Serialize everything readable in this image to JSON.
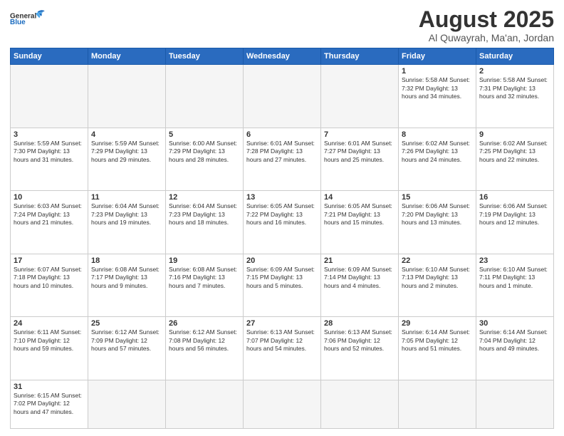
{
  "logo": {
    "text_general": "General",
    "text_blue": "Blue"
  },
  "header": {
    "title": "August 2025",
    "subtitle": "Al Quwayrah, Ma'an, Jordan"
  },
  "weekdays": [
    "Sunday",
    "Monday",
    "Tuesday",
    "Wednesday",
    "Thursday",
    "Friday",
    "Saturday"
  ],
  "weeks": [
    [
      {
        "day": "",
        "info": ""
      },
      {
        "day": "",
        "info": ""
      },
      {
        "day": "",
        "info": ""
      },
      {
        "day": "",
        "info": ""
      },
      {
        "day": "",
        "info": ""
      },
      {
        "day": "1",
        "info": "Sunrise: 5:58 AM\nSunset: 7:32 PM\nDaylight: 13 hours and 34 minutes."
      },
      {
        "day": "2",
        "info": "Sunrise: 5:58 AM\nSunset: 7:31 PM\nDaylight: 13 hours and 32 minutes."
      }
    ],
    [
      {
        "day": "3",
        "info": "Sunrise: 5:59 AM\nSunset: 7:30 PM\nDaylight: 13 hours and 31 minutes."
      },
      {
        "day": "4",
        "info": "Sunrise: 5:59 AM\nSunset: 7:29 PM\nDaylight: 13 hours and 29 minutes."
      },
      {
        "day": "5",
        "info": "Sunrise: 6:00 AM\nSunset: 7:29 PM\nDaylight: 13 hours and 28 minutes."
      },
      {
        "day": "6",
        "info": "Sunrise: 6:01 AM\nSunset: 7:28 PM\nDaylight: 13 hours and 27 minutes."
      },
      {
        "day": "7",
        "info": "Sunrise: 6:01 AM\nSunset: 7:27 PM\nDaylight: 13 hours and 25 minutes."
      },
      {
        "day": "8",
        "info": "Sunrise: 6:02 AM\nSunset: 7:26 PM\nDaylight: 13 hours and 24 minutes."
      },
      {
        "day": "9",
        "info": "Sunrise: 6:02 AM\nSunset: 7:25 PM\nDaylight: 13 hours and 22 minutes."
      }
    ],
    [
      {
        "day": "10",
        "info": "Sunrise: 6:03 AM\nSunset: 7:24 PM\nDaylight: 13 hours and 21 minutes."
      },
      {
        "day": "11",
        "info": "Sunrise: 6:04 AM\nSunset: 7:23 PM\nDaylight: 13 hours and 19 minutes."
      },
      {
        "day": "12",
        "info": "Sunrise: 6:04 AM\nSunset: 7:23 PM\nDaylight: 13 hours and 18 minutes."
      },
      {
        "day": "13",
        "info": "Sunrise: 6:05 AM\nSunset: 7:22 PM\nDaylight: 13 hours and 16 minutes."
      },
      {
        "day": "14",
        "info": "Sunrise: 6:05 AM\nSunset: 7:21 PM\nDaylight: 13 hours and 15 minutes."
      },
      {
        "day": "15",
        "info": "Sunrise: 6:06 AM\nSunset: 7:20 PM\nDaylight: 13 hours and 13 minutes."
      },
      {
        "day": "16",
        "info": "Sunrise: 6:06 AM\nSunset: 7:19 PM\nDaylight: 13 hours and 12 minutes."
      }
    ],
    [
      {
        "day": "17",
        "info": "Sunrise: 6:07 AM\nSunset: 7:18 PM\nDaylight: 13 hours and 10 minutes."
      },
      {
        "day": "18",
        "info": "Sunrise: 6:08 AM\nSunset: 7:17 PM\nDaylight: 13 hours and 9 minutes."
      },
      {
        "day": "19",
        "info": "Sunrise: 6:08 AM\nSunset: 7:16 PM\nDaylight: 13 hours and 7 minutes."
      },
      {
        "day": "20",
        "info": "Sunrise: 6:09 AM\nSunset: 7:15 PM\nDaylight: 13 hours and 5 minutes."
      },
      {
        "day": "21",
        "info": "Sunrise: 6:09 AM\nSunset: 7:14 PM\nDaylight: 13 hours and 4 minutes."
      },
      {
        "day": "22",
        "info": "Sunrise: 6:10 AM\nSunset: 7:13 PM\nDaylight: 13 hours and 2 minutes."
      },
      {
        "day": "23",
        "info": "Sunrise: 6:10 AM\nSunset: 7:11 PM\nDaylight: 13 hours and 1 minute."
      }
    ],
    [
      {
        "day": "24",
        "info": "Sunrise: 6:11 AM\nSunset: 7:10 PM\nDaylight: 12 hours and 59 minutes."
      },
      {
        "day": "25",
        "info": "Sunrise: 6:12 AM\nSunset: 7:09 PM\nDaylight: 12 hours and 57 minutes."
      },
      {
        "day": "26",
        "info": "Sunrise: 6:12 AM\nSunset: 7:08 PM\nDaylight: 12 hours and 56 minutes."
      },
      {
        "day": "27",
        "info": "Sunrise: 6:13 AM\nSunset: 7:07 PM\nDaylight: 12 hours and 54 minutes."
      },
      {
        "day": "28",
        "info": "Sunrise: 6:13 AM\nSunset: 7:06 PM\nDaylight: 12 hours and 52 minutes."
      },
      {
        "day": "29",
        "info": "Sunrise: 6:14 AM\nSunset: 7:05 PM\nDaylight: 12 hours and 51 minutes."
      },
      {
        "day": "30",
        "info": "Sunrise: 6:14 AM\nSunset: 7:04 PM\nDaylight: 12 hours and 49 minutes."
      }
    ],
    [
      {
        "day": "31",
        "info": "Sunrise: 6:15 AM\nSunset: 7:02 PM\nDaylight: 12 hours and 47 minutes."
      },
      {
        "day": "",
        "info": ""
      },
      {
        "day": "",
        "info": ""
      },
      {
        "day": "",
        "info": ""
      },
      {
        "day": "",
        "info": ""
      },
      {
        "day": "",
        "info": ""
      },
      {
        "day": "",
        "info": ""
      }
    ]
  ]
}
